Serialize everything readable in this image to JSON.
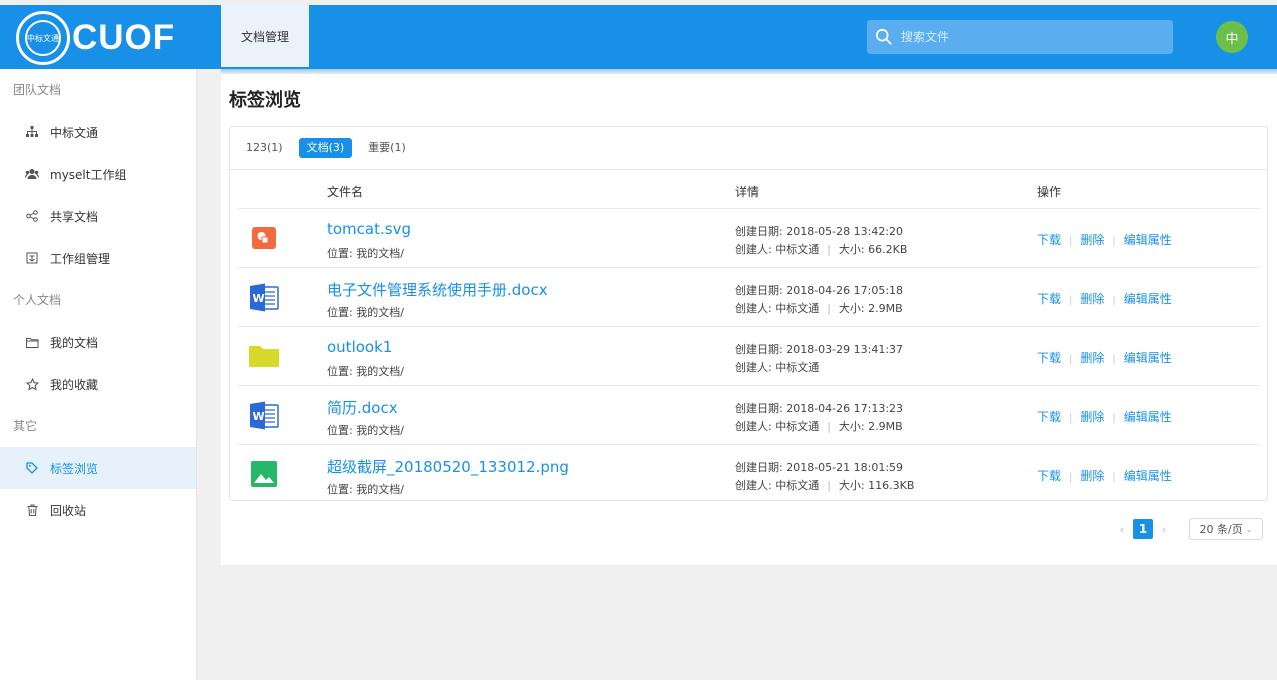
{
  "header": {
    "logo_small": "中标文通",
    "logo_text": "CUOF",
    "nav_tab": "文档管理",
    "search_placeholder": "搜索文件",
    "avatar": "中",
    "brand_color": "#1890e8"
  },
  "sidebar": {
    "groups": [
      {
        "label": "团队文档",
        "items": [
          {
            "label": "中标文通",
            "icon": "org-chart-icon"
          },
          {
            "label": "myselt工作组",
            "icon": "users-icon"
          },
          {
            "label": "共享文档",
            "icon": "share-icon"
          },
          {
            "label": "工作组管理",
            "icon": "manage-icon"
          }
        ]
      },
      {
        "label": "个人文档",
        "items": [
          {
            "label": "我的文档",
            "icon": "folder-icon"
          },
          {
            "label": "我的收藏",
            "icon": "star-icon"
          }
        ]
      },
      {
        "label": "其它",
        "items": [
          {
            "label": "标签浏览",
            "icon": "tag-icon",
            "active": true
          },
          {
            "label": "回收站",
            "icon": "trash-icon"
          }
        ]
      }
    ]
  },
  "main": {
    "title": "标签浏览",
    "tags": [
      {
        "label": "123(1)",
        "active": false
      },
      {
        "label": "文档(3)",
        "active": true
      },
      {
        "label": "重要(1)",
        "active": false
      }
    ],
    "columns": {
      "name": "文件名",
      "detail": "详情",
      "ops": "操作"
    },
    "ops_labels": {
      "download": "下载",
      "delete": "删除",
      "edit": "编辑属性"
    },
    "files": [
      {
        "name": "tomcat.svg",
        "location": "位置: 我的文档/",
        "created": "创建日期: 2018-05-28 13:42:20",
        "creator": "创建人: 中标文通",
        "size": "大小: 66.2KB",
        "icon": "svg-file-icon"
      },
      {
        "name": "电子文件管理系统使用手册.docx",
        "location": "位置: 我的文档/",
        "created": "创建日期: 2018-04-26 17:05:18",
        "creator": "创建人: 中标文通",
        "size": "大小: 2.9MB",
        "icon": "word-file-icon"
      },
      {
        "name": "outlook1",
        "location": "位置: 我的文档/",
        "created": "创建日期: 2018-03-29 13:41:37",
        "creator": "创建人: 中标文通",
        "size": "",
        "icon": "folder-file-icon"
      },
      {
        "name": "简历.docx",
        "location": "位置: 我的文档/",
        "created": "创建日期: 2018-04-26 17:13:23",
        "creator": "创建人: 中标文通",
        "size": "大小: 2.9MB",
        "icon": "word-file-icon"
      },
      {
        "name": "超级截屏_20180520_133012.png",
        "location": "位置: 我的文档/",
        "created": "创建日期: 2018-05-21 18:01:59",
        "creator": "创建人: 中标文通",
        "size": "大小: 116.3KB",
        "icon": "image-file-icon"
      }
    ],
    "pagination": {
      "prev": "‹",
      "current": "1",
      "next": "›",
      "page_size": "20 条/页"
    }
  }
}
